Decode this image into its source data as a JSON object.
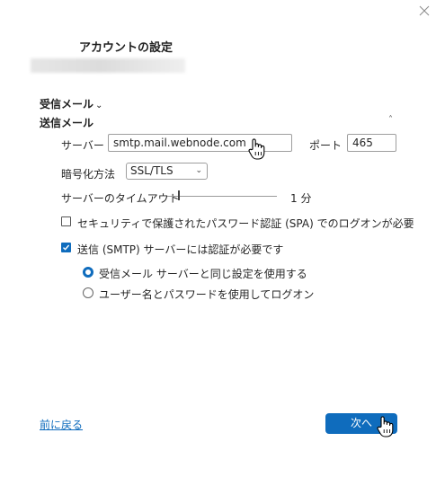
{
  "dialog": {
    "title": "アカウントの設定"
  },
  "incoming": {
    "label": "受信メール",
    "chevron": "⌄"
  },
  "outgoing": {
    "label": "送信メール",
    "collapse_glyph": "˄",
    "server_label": "サーバー",
    "server_value": "smtp.mail.webnode.com",
    "port_label": "ポート",
    "port_value": "465",
    "encryption_label": "暗号化方法",
    "encryption_value": "SSL/TLS",
    "timeout_label": "サーバーのタイムアウト",
    "timeout_value": "1 分",
    "timeout_fraction": 0.0,
    "spa_label": "セキュリティで保護されたパスワード認証 (SPA) でのログオンが必要",
    "spa_checked": false,
    "smtp_auth_label": "送信 (SMTP) サーバーには認証が必要です",
    "smtp_auth_checked": true,
    "radio_same_label": "受信メール サーバーと同じ設定を使用する",
    "radio_same_selected": true,
    "radio_logon_label": "ユーザー名とパスワードを使用してログオン",
    "radio_logon_selected": false
  },
  "footer": {
    "back_label": "前に戻る",
    "next_label": "次へ"
  },
  "colors": {
    "accent": "#0f6cbd"
  },
  "icons": {
    "close": "close-icon",
    "cursor": "hand-pointer-icon"
  }
}
